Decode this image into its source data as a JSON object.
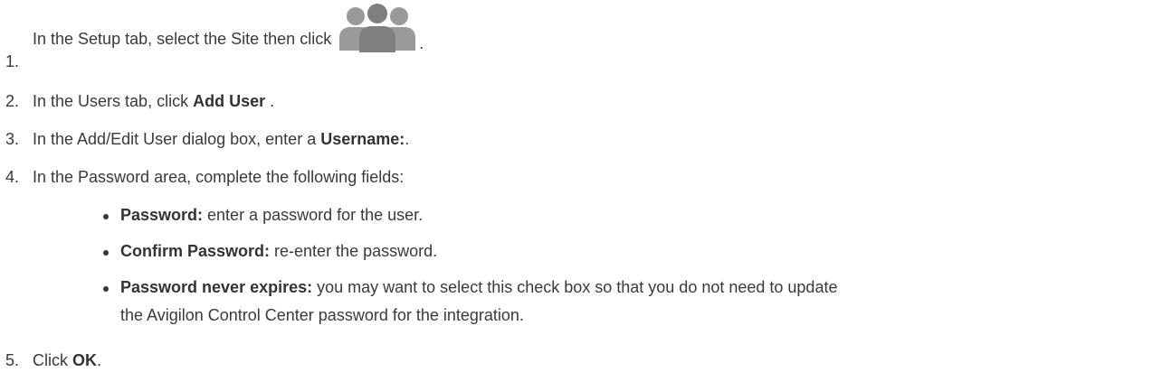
{
  "steps": [
    {
      "num": "1.",
      "pre": "In the Setup tab, select the Site then click ",
      "post": "."
    },
    {
      "num": "2.",
      "pre": "In the Users tab, click ",
      "bold": "Add User",
      "post": " ."
    },
    {
      "num": "3.",
      "pre": "In the Add/Edit User dialog box, enter a ",
      "bold": "Username:",
      "post": "."
    },
    {
      "num": "4.",
      "pre": "In the Password area, complete the following fields:"
    },
    {
      "num": "5.",
      "pre": "Click ",
      "bold": "OK",
      "post": "."
    }
  ],
  "bullets": [
    {
      "bold": "Password:",
      "text": " enter a password for the user."
    },
    {
      "bold": "Confirm Password:",
      "text": " re-enter the password."
    },
    {
      "bold": "Password never expires:",
      "text": " you may want to select this check box so that you do not need to update",
      "text2": "the Avigilon Control Center password for the integration."
    }
  ],
  "icons": {
    "users_icon": "users-group-icon",
    "icon_color": "#8a8a8a"
  }
}
